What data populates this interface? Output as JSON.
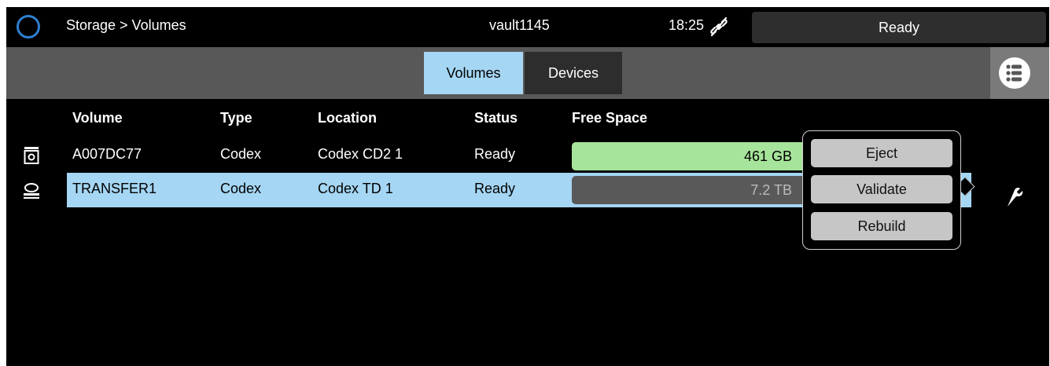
{
  "topbar": {
    "breadcrumb": "Storage > Volumes",
    "hostname": "vault1145",
    "time": "18:25",
    "status": "Ready"
  },
  "tabs": [
    {
      "label": "Volumes",
      "active": true
    },
    {
      "label": "Devices",
      "active": false
    }
  ],
  "table": {
    "columns": [
      "Volume",
      "Type",
      "Location",
      "Status",
      "Free Space"
    ],
    "rows": [
      {
        "volume": "A007DC77",
        "type": "Codex",
        "location": "Codex CD2 1",
        "status": "Ready",
        "free": "461 GB",
        "fill_fraction": 0.72,
        "selected": false,
        "icon": "drive-icon"
      },
      {
        "volume": "TRANSFER1",
        "type": "Codex",
        "location": "Codex TD 1",
        "status": "Ready",
        "free": "7.2 TB",
        "fill_fraction": 0.0,
        "selected": true,
        "icon": "disk-drive-icon"
      }
    ]
  },
  "popup_menu": {
    "items": [
      "Eject",
      "Validate",
      "Rebuild"
    ]
  },
  "colors": {
    "accent": "#a5d6f3",
    "free_space_fill": "#a7e49b",
    "toolbar": "#585858",
    "brand_ring": "#2f7fd0"
  }
}
